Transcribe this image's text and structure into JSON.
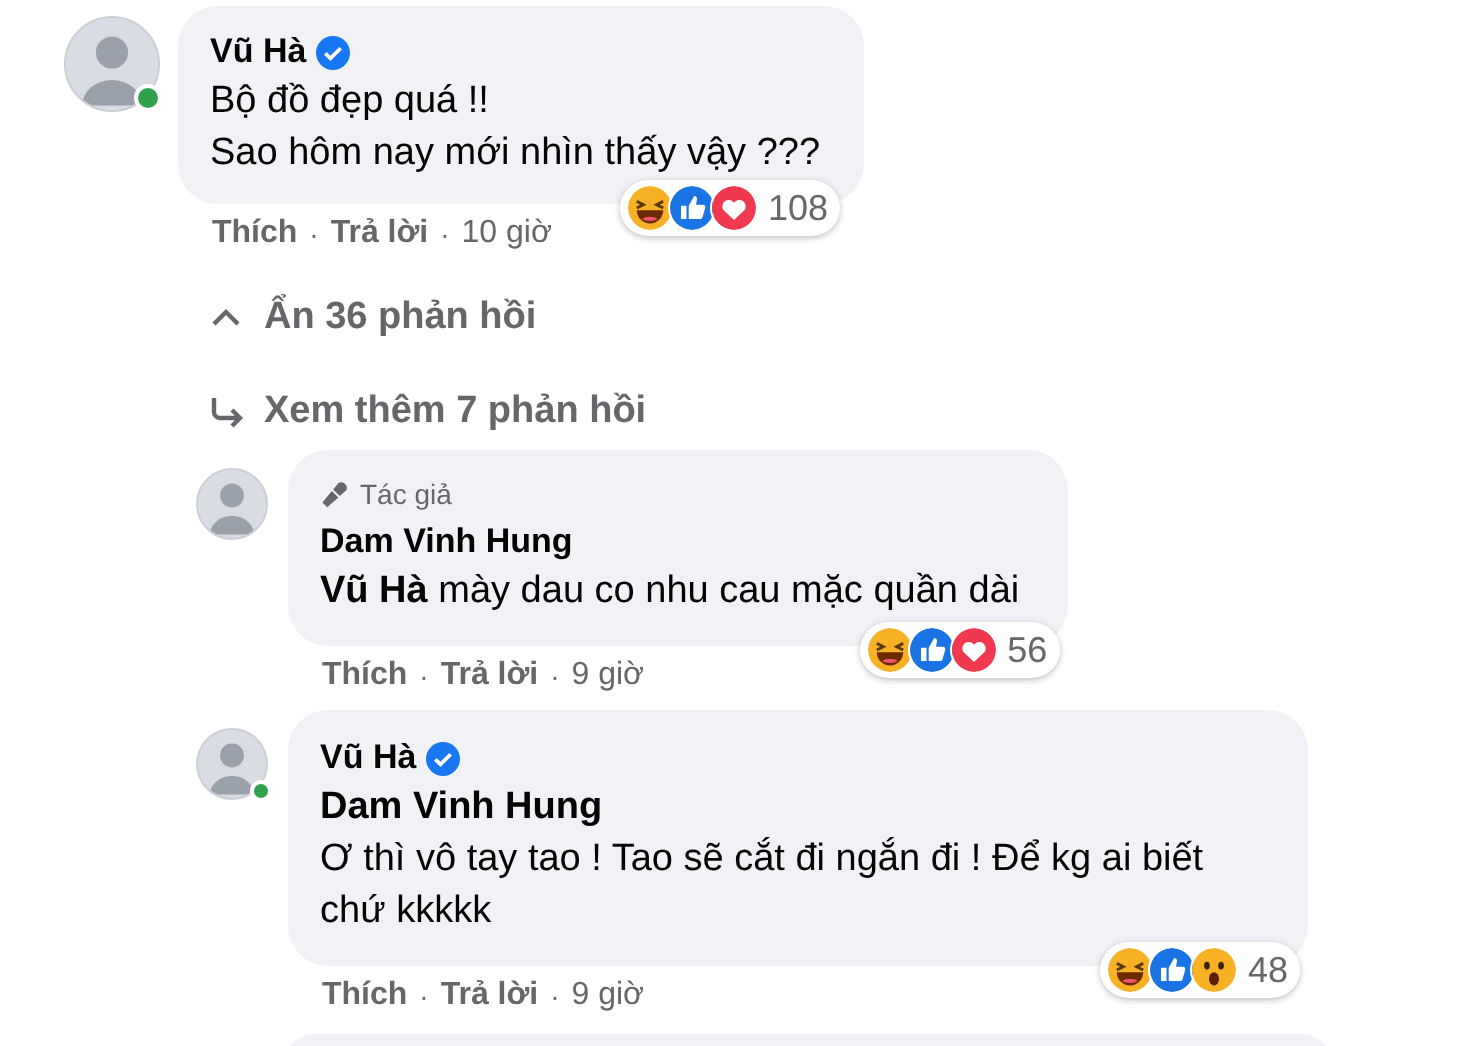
{
  "comments": [
    {
      "kind": "comment",
      "name": "Vũ Hà",
      "verified": true,
      "online": true,
      "lines": [
        "Bộ đồ đẹp quá !!",
        "Sao hôm nay mới nhìn thấy vậy ???"
      ],
      "reactions": [
        {
          "kind": "haha"
        },
        {
          "kind": "like"
        },
        {
          "kind": "love"
        }
      ],
      "reaction_count": "108",
      "actions": [
        "Thích",
        "Trả lời",
        "10 giờ"
      ],
      "separator": "·"
    },
    {
      "kind": "hide_replies",
      "label": "Ẩn 36 phản hồi"
    },
    {
      "kind": "more_replies",
      "label": "Xem thêm 7 phản hồi"
    },
    {
      "kind": "reply",
      "badge": "Tác giả",
      "name": "Dam Vinh Hung",
      "verified": false,
      "online": false,
      "lines": [
        "**Vũ Hà** mày dau co nhu cau mặc quần dài"
      ],
      "reactions": [
        {
          "kind": "haha"
        },
        {
          "kind": "like"
        },
        {
          "kind": "love"
        }
      ],
      "reaction_count": "56",
      "actions": [
        "Thích",
        "Trả lời",
        "9 giờ"
      ],
      "separator": "·"
    },
    {
      "kind": "reply",
      "name": "Vũ Hà",
      "verified": true,
      "online": true,
      "tag": "Dam Vinh Hung",
      "lines": [
        "Ơ thì vô tay tao ! Tao sẽ cắt đi ngắn đi ! Để kg ai biết chứ kkkkk"
      ],
      "reactions": [
        {
          "kind": "haha"
        },
        {
          "kind": "like"
        },
        {
          "kind": "wow"
        }
      ],
      "reaction_count": "48",
      "actions": [
        "Thích",
        "Trả lời",
        "9 giờ"
      ],
      "separator": "·"
    },
    {
      "kind": "reply_partial"
    }
  ]
}
